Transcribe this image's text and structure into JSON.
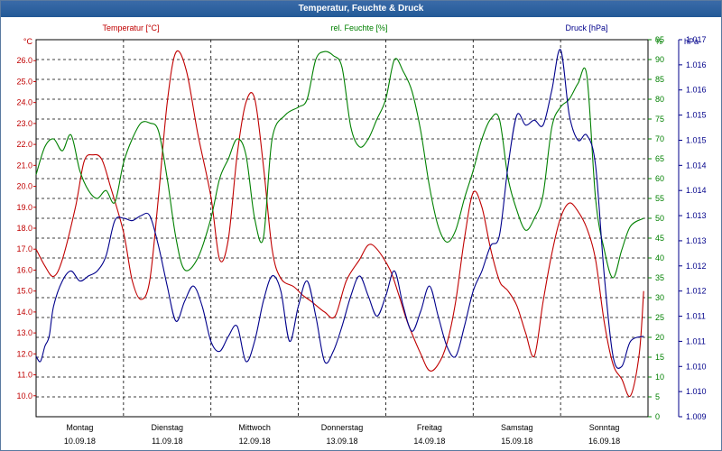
{
  "window": {
    "title": "Temperatur, Feuchte & Druck"
  },
  "chart_data": {
    "type": "line",
    "title": "Temperatur, Feuchte & Druck",
    "grid": true,
    "colors": {
      "temperature": "#c00000",
      "humidity": "#008000",
      "pressure": "#00008b",
      "grid": "#000000"
    },
    "axes": {
      "left": {
        "unit_label": "°C",
        "header": "Temperatur [°C]",
        "min": 9.0,
        "max": 27.0,
        "tick_start": 10.0,
        "tick_step": 1.0,
        "tick_count": 17,
        "ticks": [
          "10.0",
          "11.0",
          "12.0",
          "13.0",
          "14.0",
          "15.0",
          "16.0",
          "17.0",
          "18.0",
          "19.0",
          "20.0",
          "21.0",
          "22.0",
          "23.0",
          "24.0",
          "25.0",
          "26.0"
        ]
      },
      "middle": {
        "unit_label": "%",
        "header": "rel. Feuchte [%]",
        "min": 0,
        "max": 95,
        "tick_start": 0,
        "tick_step": 5,
        "tick_count": 20,
        "ticks": [
          "0",
          "5",
          "10",
          "15",
          "20",
          "25",
          "30",
          "35",
          "40",
          "45",
          "50",
          "55",
          "60",
          "65",
          "70",
          "75",
          "80",
          "85",
          "90",
          "95"
        ]
      },
      "right": {
        "unit_label": "hPa",
        "header": "Druck [hPa]",
        "min": 1009.0,
        "max": 1016.5,
        "tick_start": 1009.0,
        "tick_step": 0.5,
        "tick_count": 16,
        "ticks": [
          "1.009",
          "1.010",
          "1.010",
          "1.011",
          "1.011",
          "1.012",
          "1.012",
          "1.013",
          "1.013",
          "1.014",
          "1.014",
          "1.015",
          "1.015",
          "1.016",
          "1.016",
          "1.017"
        ]
      },
      "x": {
        "min": 0,
        "max": 7,
        "days": [
          {
            "name": "Montag",
            "date": "10.09.18"
          },
          {
            "name": "Dienstag",
            "date": "11.09.18"
          },
          {
            "name": "Mittwoch",
            "date": "12.09.18"
          },
          {
            "name": "Donnerstag",
            "date": "13.09.18"
          },
          {
            "name": "Freitag",
            "date": "14.09.18"
          },
          {
            "name": "Samstag",
            "date": "15.09.18"
          },
          {
            "name": "Sonntag",
            "date": "16.09.18"
          }
        ]
      }
    },
    "series": [
      {
        "name": "Temperatur [°C]",
        "axis": "left",
        "color": "#c00000",
        "x": [
          0,
          0.1,
          0.2,
          0.3,
          0.45,
          0.55,
          0.65,
          0.75,
          0.85,
          1.0,
          1.1,
          1.2,
          1.3,
          1.4,
          1.5,
          1.6,
          1.72,
          1.85,
          2.0,
          2.1,
          2.2,
          2.3,
          2.4,
          2.5,
          2.6,
          2.7,
          2.8,
          2.95,
          3.05,
          3.15,
          3.3,
          3.42,
          3.55,
          3.7,
          3.8,
          3.9,
          4.05,
          4.15,
          4.25,
          4.4,
          4.5,
          4.6,
          4.7,
          4.8,
          4.9,
          5.0,
          5.1,
          5.2,
          5.3,
          5.35,
          5.4,
          5.5,
          5.6,
          5.7,
          5.8,
          5.9,
          6.0,
          6.1,
          6.2,
          6.3,
          6.4,
          6.5,
          6.6,
          6.7,
          6.8,
          6.9,
          6.95
        ],
        "values": [
          17.0,
          16.2,
          15.7,
          16.5,
          19.0,
          21.2,
          21.5,
          21.3,
          20.0,
          17.8,
          15.5,
          14.6,
          15.5,
          19.5,
          24.0,
          26.4,
          25.5,
          22.5,
          19.5,
          16.5,
          17.5,
          21.5,
          24.0,
          24.2,
          21.0,
          17.0,
          15.6,
          15.2,
          14.8,
          14.5,
          14.0,
          13.8,
          15.5,
          16.5,
          17.2,
          17.0,
          16.0,
          14.8,
          13.5,
          12.0,
          11.2,
          11.5,
          12.5,
          14.5,
          17.5,
          19.7,
          19.0,
          17.0,
          15.5,
          15.2,
          15.0,
          14.3,
          13.0,
          11.9,
          14.5,
          16.8,
          18.5,
          19.2,
          18.8,
          18.0,
          16.5,
          13.5,
          11.5,
          10.8,
          10.0,
          12.0,
          15.0
        ]
      },
      {
        "name": "rel. Feuchte [%]",
        "axis": "middle",
        "color": "#008000",
        "x": [
          0,
          0.1,
          0.2,
          0.3,
          0.4,
          0.5,
          0.6,
          0.7,
          0.8,
          0.9,
          1.0,
          1.1,
          1.2,
          1.3,
          1.4,
          1.5,
          1.6,
          1.7,
          1.85,
          2.0,
          2.1,
          2.2,
          2.3,
          2.4,
          2.5,
          2.6,
          2.7,
          2.85,
          3.0,
          3.1,
          3.2,
          3.3,
          3.4,
          3.5,
          3.6,
          3.7,
          3.8,
          3.9,
          4.0,
          4.1,
          4.2,
          4.3,
          4.4,
          4.5,
          4.6,
          4.7,
          4.8,
          4.9,
          5.0,
          5.1,
          5.2,
          5.3,
          5.4,
          5.5,
          5.6,
          5.7,
          5.8,
          5.9,
          6.0,
          6.1,
          6.2,
          6.3,
          6.4,
          6.5,
          6.6,
          6.7,
          6.8,
          6.95
        ],
        "values": [
          61,
          68,
          70,
          67,
          71,
          62,
          57,
          55,
          57,
          54,
          64,
          70,
          74,
          74,
          72,
          60,
          45,
          37,
          40,
          50,
          60,
          65,
          70,
          66,
          50,
          45,
          70,
          76,
          78,
          80,
          90,
          92,
          91,
          88,
          73,
          68,
          70,
          75,
          80,
          90,
          87,
          82,
          72,
          58,
          48,
          44,
          47,
          55,
          62,
          70,
          75,
          75,
          60,
          52,
          47,
          50,
          56,
          73,
          78,
          80,
          84,
          86,
          55,
          42,
          35,
          42,
          48,
          50
        ]
      },
      {
        "name": "Druck [hPa]",
        "axis": "right",
        "color": "#00008b",
        "x": [
          0,
          0.05,
          0.1,
          0.15,
          0.2,
          0.3,
          0.4,
          0.5,
          0.6,
          0.7,
          0.8,
          0.9,
          1.0,
          1.1,
          1.2,
          1.3,
          1.4,
          1.5,
          1.6,
          1.7,
          1.8,
          1.9,
          2.0,
          2.1,
          2.2,
          2.3,
          2.4,
          2.5,
          2.6,
          2.7,
          2.8,
          2.9,
          3.0,
          3.1,
          3.2,
          3.3,
          3.4,
          3.5,
          3.6,
          3.7,
          3.8,
          3.9,
          4.0,
          4.1,
          4.2,
          4.3,
          4.4,
          4.5,
          4.6,
          4.7,
          4.8,
          4.9,
          5.0,
          5.1,
          5.2,
          5.3,
          5.4,
          5.5,
          5.6,
          5.7,
          5.8,
          5.9,
          6.0,
          6.1,
          6.2,
          6.3,
          6.4,
          6.5,
          6.6,
          6.7,
          6.8,
          6.95
        ],
        "values": [
          1010.2,
          1010.1,
          1010.4,
          1010.6,
          1011.2,
          1011.7,
          1011.9,
          1011.7,
          1011.8,
          1011.9,
          1012.2,
          1012.9,
          1012.95,
          1012.9,
          1013.0,
          1013.0,
          1012.4,
          1011.6,
          1010.9,
          1011.3,
          1011.6,
          1011.2,
          1010.5,
          1010.3,
          1010.6,
          1010.8,
          1010.1,
          1010.5,
          1011.3,
          1011.8,
          1011.5,
          1010.5,
          1011.2,
          1011.7,
          1011.0,
          1010.1,
          1010.3,
          1010.8,
          1011.4,
          1011.8,
          1011.4,
          1011.0,
          1011.4,
          1011.9,
          1011.2,
          1010.7,
          1011.1,
          1011.6,
          1011.0,
          1010.4,
          1010.2,
          1010.8,
          1011.5,
          1011.9,
          1012.4,
          1012.6,
          1014.0,
          1015.0,
          1014.8,
          1014.9,
          1014.8,
          1015.5,
          1016.3,
          1015.0,
          1014.5,
          1014.6,
          1014.0,
          1011.8,
          1010.2,
          1010.0,
          1010.5,
          1010.6
        ]
      }
    ]
  }
}
